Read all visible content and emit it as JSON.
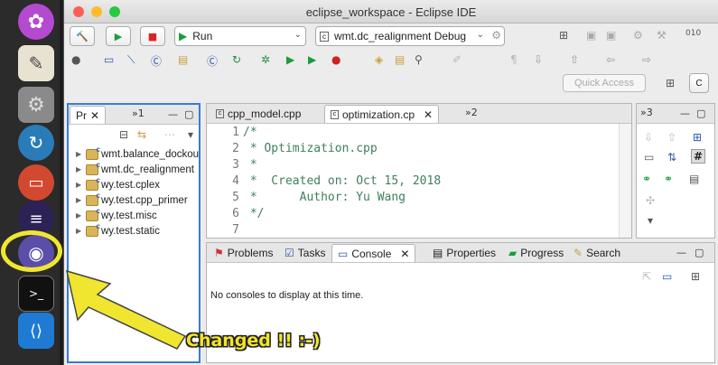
{
  "window": {
    "title": "eclipse_workspace - Eclipse IDE"
  },
  "toolbar": {
    "run_combo": "Run",
    "config_combo": "wmt.dc_realignment Debug",
    "quick_access": "Quick Access"
  },
  "project_explorer": {
    "tab_label": "Pr",
    "overflow": "»1",
    "items": [
      "wmt.balance_dockou",
      "wmt.dc_realignment",
      "wy.test.cplex",
      "wy.test.cpp_primer",
      "wy.test.misc",
      "wy.test.static"
    ]
  },
  "editor": {
    "tabs": [
      "cpp_model.cpp",
      "optimization.cp"
    ],
    "overflow": "»2",
    "lines": [
      {
        "n": "1",
        "text": "/*"
      },
      {
        "n": "2",
        "text": " * Optimization.cpp"
      },
      {
        "n": "3",
        "text": " *"
      },
      {
        "n": "4",
        "text": " *  Created on: Oct 15, 2018"
      },
      {
        "n": "5",
        "text": " *      Author: Yu Wang"
      },
      {
        "n": "6",
        "text": " */"
      },
      {
        "n": "7",
        "text": ""
      }
    ]
  },
  "outline": {
    "overflow": "»3"
  },
  "bottom": {
    "tabs": [
      "Problems",
      "Tasks",
      "Console",
      "Properties",
      "Progress",
      "Search"
    ],
    "message": "No consoles to display at this time."
  },
  "annotation": {
    "callout": "Changed !! :-)"
  },
  "colors": {
    "highlight": "#f1e62f",
    "code_comment": "#3f7f5f"
  }
}
